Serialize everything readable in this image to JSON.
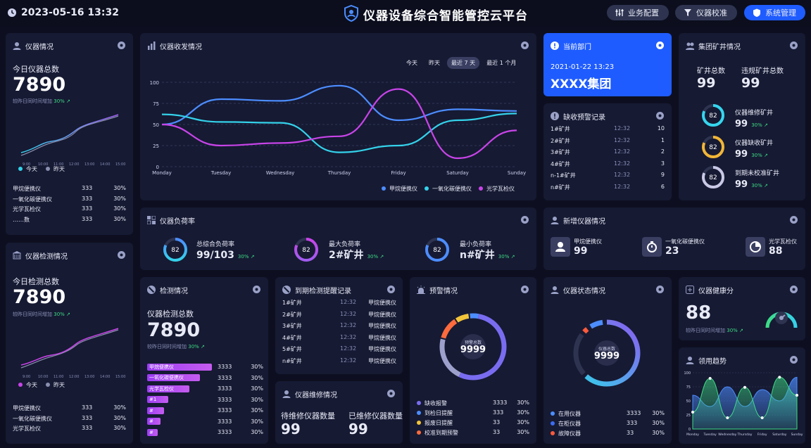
{
  "header": {
    "datetime": "2023-05-16 13:32",
    "title": "仪器设备综合智能管控云平台",
    "btn_config": "业务配置",
    "btn_calib": "仪器校准",
    "btn_system": "系统管理"
  },
  "instrument": {
    "title": "仪器情况",
    "today_label": "今日仪器总数",
    "today_value": "7890",
    "compare": "较昨日同时间增加",
    "pct": "30%",
    "legend_today": "今天",
    "legend_yesterday": "昨天",
    "times": [
      "9:00",
      "10:00",
      "11:00",
      "12:00",
      "13:00",
      "14:00",
      "15:00"
    ],
    "rows": [
      {
        "name": "甲烷便携仪",
        "count": "333",
        "pct": "30%"
      },
      {
        "name": "一氧化碳便携仪",
        "count": "333",
        "pct": "30%"
      },
      {
        "name": "光学瓦检仪",
        "count": "333",
        "pct": "30%"
      },
      {
        "name": "……数",
        "count": "333",
        "pct": "30%"
      }
    ]
  },
  "detection": {
    "title": "仪器检测情况",
    "today_label": "今日检测总数",
    "today_value": "7890",
    "compare": "较昨日同时间增加",
    "pct": "30%",
    "legend_today": "今天",
    "legend_yesterday": "昨天",
    "times": [
      "9:00",
      "10:00",
      "11:00",
      "12:00",
      "13:00",
      "14:00",
      "15:00"
    ],
    "rows": [
      {
        "name": "甲烷便携仪",
        "count": "333",
        "pct": "30%"
      },
      {
        "name": "一氧化碳便携仪",
        "count": "333",
        "pct": "30%"
      },
      {
        "name": "光学瓦检仪",
        "count": "333",
        "pct": "30%"
      }
    ]
  },
  "transceive": {
    "title": "仪器收发情况",
    "tabs": [
      "今天",
      "昨天",
      "最近 7 天",
      "最近 1 个月"
    ],
    "active_tab": "最近 7 天"
  },
  "chart_data": {
    "type": "line",
    "categories": [
      "Monday",
      "Tuesday",
      "Wednesday",
      "Thursday",
      "Friday",
      "Saturday",
      "Sunday"
    ],
    "ylim": [
      0,
      100
    ],
    "yticks": [
      0,
      25,
      50,
      75,
      100
    ],
    "series": [
      {
        "name": "甲烷便携仪",
        "color": "#4c8dff",
        "values": [
          50,
          80,
          78,
          96,
          55,
          68,
          66
        ]
      },
      {
        "name": "一氧化碳便携仪",
        "color": "#34d2ea",
        "values": [
          62,
          53,
          52,
          17,
          25,
          55,
          63
        ]
      },
      {
        "name": "光学瓦检仪",
        "color": "#c844e8",
        "values": [
          50,
          25,
          28,
          36,
          92,
          10,
          43
        ]
      }
    ]
  },
  "dept": {
    "title": "当前部门",
    "datetime": "2021-01-22 13:23",
    "name": "XXXX集团"
  },
  "alarm_records": {
    "title": "缺收预警记录",
    "rows": [
      {
        "name": "1#矿井",
        "time": "12:32",
        "value": "10"
      },
      {
        "name": "2#矿井",
        "time": "12:32",
        "value": "1"
      },
      {
        "name": "3#矿井",
        "time": "12:32",
        "value": "2"
      },
      {
        "name": "4#矿井",
        "time": "12:32",
        "value": "3"
      },
      {
        "name": "n-1#矿井",
        "time": "12:32",
        "value": "9"
      },
      {
        "name": "n#矿井",
        "time": "12:32",
        "value": "6"
      }
    ]
  },
  "mines": {
    "title": "集团矿井情况",
    "total_label": "矿井总数",
    "total_value": "99",
    "violation_label": "违规矿井总数",
    "violation_value": "99",
    "items": [
      {
        "label": "仪器维修矿井",
        "value": "99",
        "pct": "30%",
        "ring": "82",
        "color": "#35d6ee"
      },
      {
        "label": "仪器缺收矿井",
        "value": "99",
        "pct": "30%",
        "ring": "82",
        "color": "#f2b636"
      },
      {
        "label": "到期未校准矿井",
        "value": "99",
        "pct": "30%",
        "ring": "82",
        "color": "#c9c9e6"
      }
    ]
  },
  "load": {
    "title": "仪器负荷率",
    "items": [
      {
        "label": "总综合负荷率",
        "value": "99/103",
        "pct": "30%",
        "ring": "82"
      },
      {
        "label": "最大负荷率",
        "value": "2#矿井",
        "pct": "30%",
        "ring": "82"
      },
      {
        "label": "最小负荷率",
        "value": "n#矿井",
        "pct": "30%",
        "ring": "82"
      }
    ]
  },
  "new_instruments": {
    "title": "新增仪器情况",
    "items": [
      {
        "label": "甲烷便携仪",
        "value": "99"
      },
      {
        "label": "一氧化碳便携仪",
        "value": "23"
      },
      {
        "label": "光学瓦检仪",
        "value": "88"
      }
    ]
  },
  "check": {
    "title": "检测情况",
    "total_label": "仪器检测总数",
    "total_value": "7890",
    "compare": "较昨日同时间增加",
    "pct": "30%",
    "rows": [
      {
        "name": "甲烷便携仪",
        "count": "3333",
        "pct": "30%",
        "frac": 0.96
      },
      {
        "name": "一氧化碳便携仪",
        "count": "3333",
        "pct": "30%",
        "frac": 0.78
      },
      {
        "name": "光学瓦检仪",
        "count": "3333",
        "pct": "30%",
        "frac": 0.62
      },
      {
        "name": "#1",
        "count": "3333",
        "pct": "30%",
        "frac": 0.31
      },
      {
        "name": "#",
        "count": "3333",
        "pct": "30%",
        "frac": 0.25
      },
      {
        "name": "#",
        "count": "3333",
        "pct": "30%",
        "frac": 0.2
      },
      {
        "name": "#",
        "count": "3333",
        "pct": "30%",
        "frac": 0.16
      }
    ]
  },
  "expiry": {
    "title": "到期检测提醒记录",
    "rows": [
      {
        "name": "1#矿井",
        "time": "12:32",
        "type": "甲烷便携仪"
      },
      {
        "name": "2#矿井",
        "time": "12:32",
        "type": "甲烷便携仪"
      },
      {
        "name": "3#矿井",
        "time": "12:32",
        "type": "甲烷便携仪"
      },
      {
        "name": "4#矿井",
        "time": "12:32",
        "type": "甲烷便携仪"
      },
      {
        "name": "5#矿井",
        "time": "12:32",
        "type": "甲烷便携仪"
      },
      {
        "name": "n#矿井",
        "time": "12:32",
        "type": "甲烷便携仪"
      }
    ]
  },
  "repair": {
    "title": "仪器维修情况",
    "pending_label": "待维修仪器数量",
    "pending_value": "99",
    "done_label": "已维修仪器数量",
    "done_value": "99"
  },
  "warning": {
    "title": "预警情况",
    "center_label": "预警总数",
    "center_value": "9999",
    "rows": [
      {
        "name": "缺收报警",
        "count": "3333",
        "pct": "30%",
        "color": "#7a6cf0"
      },
      {
        "name": "到检日提醒",
        "count": "333",
        "pct": "30%",
        "color": "#4c8dff"
      },
      {
        "name": "报废日提醒",
        "count": "33",
        "pct": "30%",
        "color": "#f2c53a"
      },
      {
        "name": "校准到期预警",
        "count": "33",
        "pct": "30%",
        "color": "#ff6b3d"
      }
    ]
  },
  "status": {
    "title": "仪器状态情况",
    "center_label": "仪器总数",
    "center_value": "9999",
    "rows": [
      {
        "name": "在用仪器",
        "count": "3333",
        "pct": "30%",
        "color": "#4c8dff"
      },
      {
        "name": "在柜仪器",
        "count": "333",
        "pct": "30%",
        "color": "#3d6cf0"
      },
      {
        "name": "故障仪器",
        "count": "33",
        "pct": "30%",
        "color": "#ff5a3d"
      }
    ]
  },
  "health": {
    "title": "仪器健康分",
    "value": "88",
    "compare": "较昨日同时间增加",
    "pct": "30%",
    "score": 88
  },
  "trend": {
    "title": "领用趋势",
    "days": [
      "Monday",
      "Tuesday",
      "Wednesday",
      "Thursday",
      "Friday",
      "Saturday",
      "Sunday"
    ],
    "yticks": [
      0,
      25,
      50,
      75,
      100
    ],
    "a": [
      30,
      90,
      20,
      74,
      20,
      92,
      60
    ],
    "b": [
      60,
      40,
      75,
      40,
      70,
      50,
      92
    ]
  }
}
